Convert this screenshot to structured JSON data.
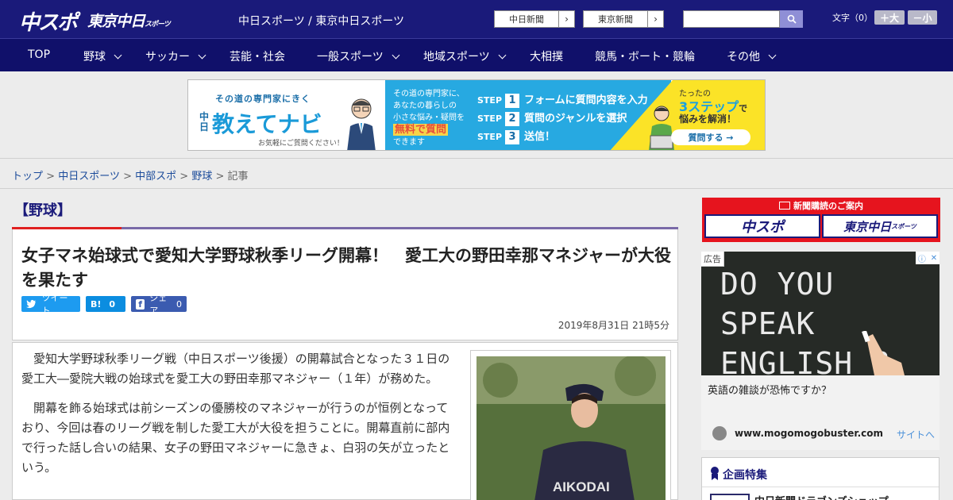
{
  "header": {
    "logo_chusupo": "中スポ",
    "logo_tokyo": "東京中日",
    "logo_tokyo_sub": "スポーツ",
    "site_name": "中日スポーツ / 東京中日スポーツ",
    "links": [
      {
        "label": "中日新聞"
      },
      {
        "label": "東京新聞"
      }
    ],
    "search_placeholder": "",
    "font_size_label": "文字（0）",
    "font_larger": "＋大",
    "font_smaller": "－小"
  },
  "nav": {
    "items": [
      {
        "label": "TOP",
        "dropdown": false
      },
      {
        "label": "野球",
        "dropdown": true
      },
      {
        "label": "サッカー",
        "dropdown": true
      },
      {
        "label": "芸能・社会",
        "dropdown": false
      },
      {
        "label": "一般スポーツ",
        "dropdown": true
      },
      {
        "label": "地域スポーツ",
        "dropdown": true
      },
      {
        "label": "大相撲",
        "dropdown": false
      },
      {
        "label": "競馬・ボート・競輪",
        "dropdown": false
      },
      {
        "label": "その他",
        "dropdown": true
      }
    ]
  },
  "banner": {
    "tagline": "その道の専門家にきく",
    "brand_prefix": "中日",
    "brand": "教えてナビ",
    "note": "お気軽にご質問ください！",
    "mid_line1": "その道の専門家に、",
    "mid_line2": "あなたの暮らしの",
    "mid_line3": "小さな悩み・疑問を",
    "mid_highlight": "無料で質問",
    "mid_line4": "できます",
    "step_word": "STEP",
    "steps": [
      {
        "num": "1",
        "text": "フォームに質問内容を入力"
      },
      {
        "num": "2",
        "text": "質問のジャンルを選択"
      },
      {
        "num": "3",
        "text": "送信！"
      }
    ],
    "right_line1": "たったの",
    "right_line2": "3ステップ",
    "right_line2_suffix": "で",
    "right_line3": "悩みを解消！",
    "cta": "質問する →"
  },
  "breadcrumb": {
    "items": [
      "トップ",
      "中日スポーツ",
      "中部スポ",
      "野球"
    ],
    "current": "記事",
    "separator": ">"
  },
  "article": {
    "category": "【野球】",
    "title": "女子マネ始球式で愛知大学野球秋季リーグ開幕！　愛工大の野田幸那マネジャーが大役を果たす",
    "share": {
      "tweet": "ツイート",
      "hatena": "B!",
      "hatena_count": "0",
      "facebook": "シェア",
      "facebook_count": "0"
    },
    "date": "2019年8月31日 21時5分",
    "paragraphs": [
      "愛知大学野球秋季リーグ戦（中日スポーツ後援）の開幕試合となった３１日の愛工大―愛院大戦の始球式を愛工大の野田幸那マネジャー（１年）が務めた。",
      "開幕を飾る始球式は前シーズンの優勝校のマネジャーが行うのが恒例となっており、今回は春のリーグ戦を制した愛工大が大役を担うことに。開幕直前に部内で行った話し合いの結果、女子の野田マネジャーに急きょ、白羽の矢が立ったという。"
    ],
    "photo_uniform_text": "AIKODAI"
  },
  "sidebar": {
    "subscription_title": "新聞購読のご案内",
    "sub_logos": [
      "中スポ",
      "東京中日"
    ],
    "sub_logo_tokyo_sub": "スポーツ",
    "ad": {
      "label": "広告",
      "chalk_line1": "DO YOU SPEAK",
      "chalk_line2": "ENGLISH ?",
      "caption": "英語の雑談が恐怖ですか？",
      "domain": "www.mogomogobuster.com",
      "cta": "サイトへ"
    },
    "special": {
      "title": "企画特集",
      "first_item": "中日新聞ドラゴンズショップ"
    }
  },
  "colors": {
    "header_bg": "#1a1a7a",
    "nav_bg": "#10106a",
    "accent_red": "#e02020",
    "accent_purple": "#7a6aa8",
    "link": "#1a4a9a"
  }
}
